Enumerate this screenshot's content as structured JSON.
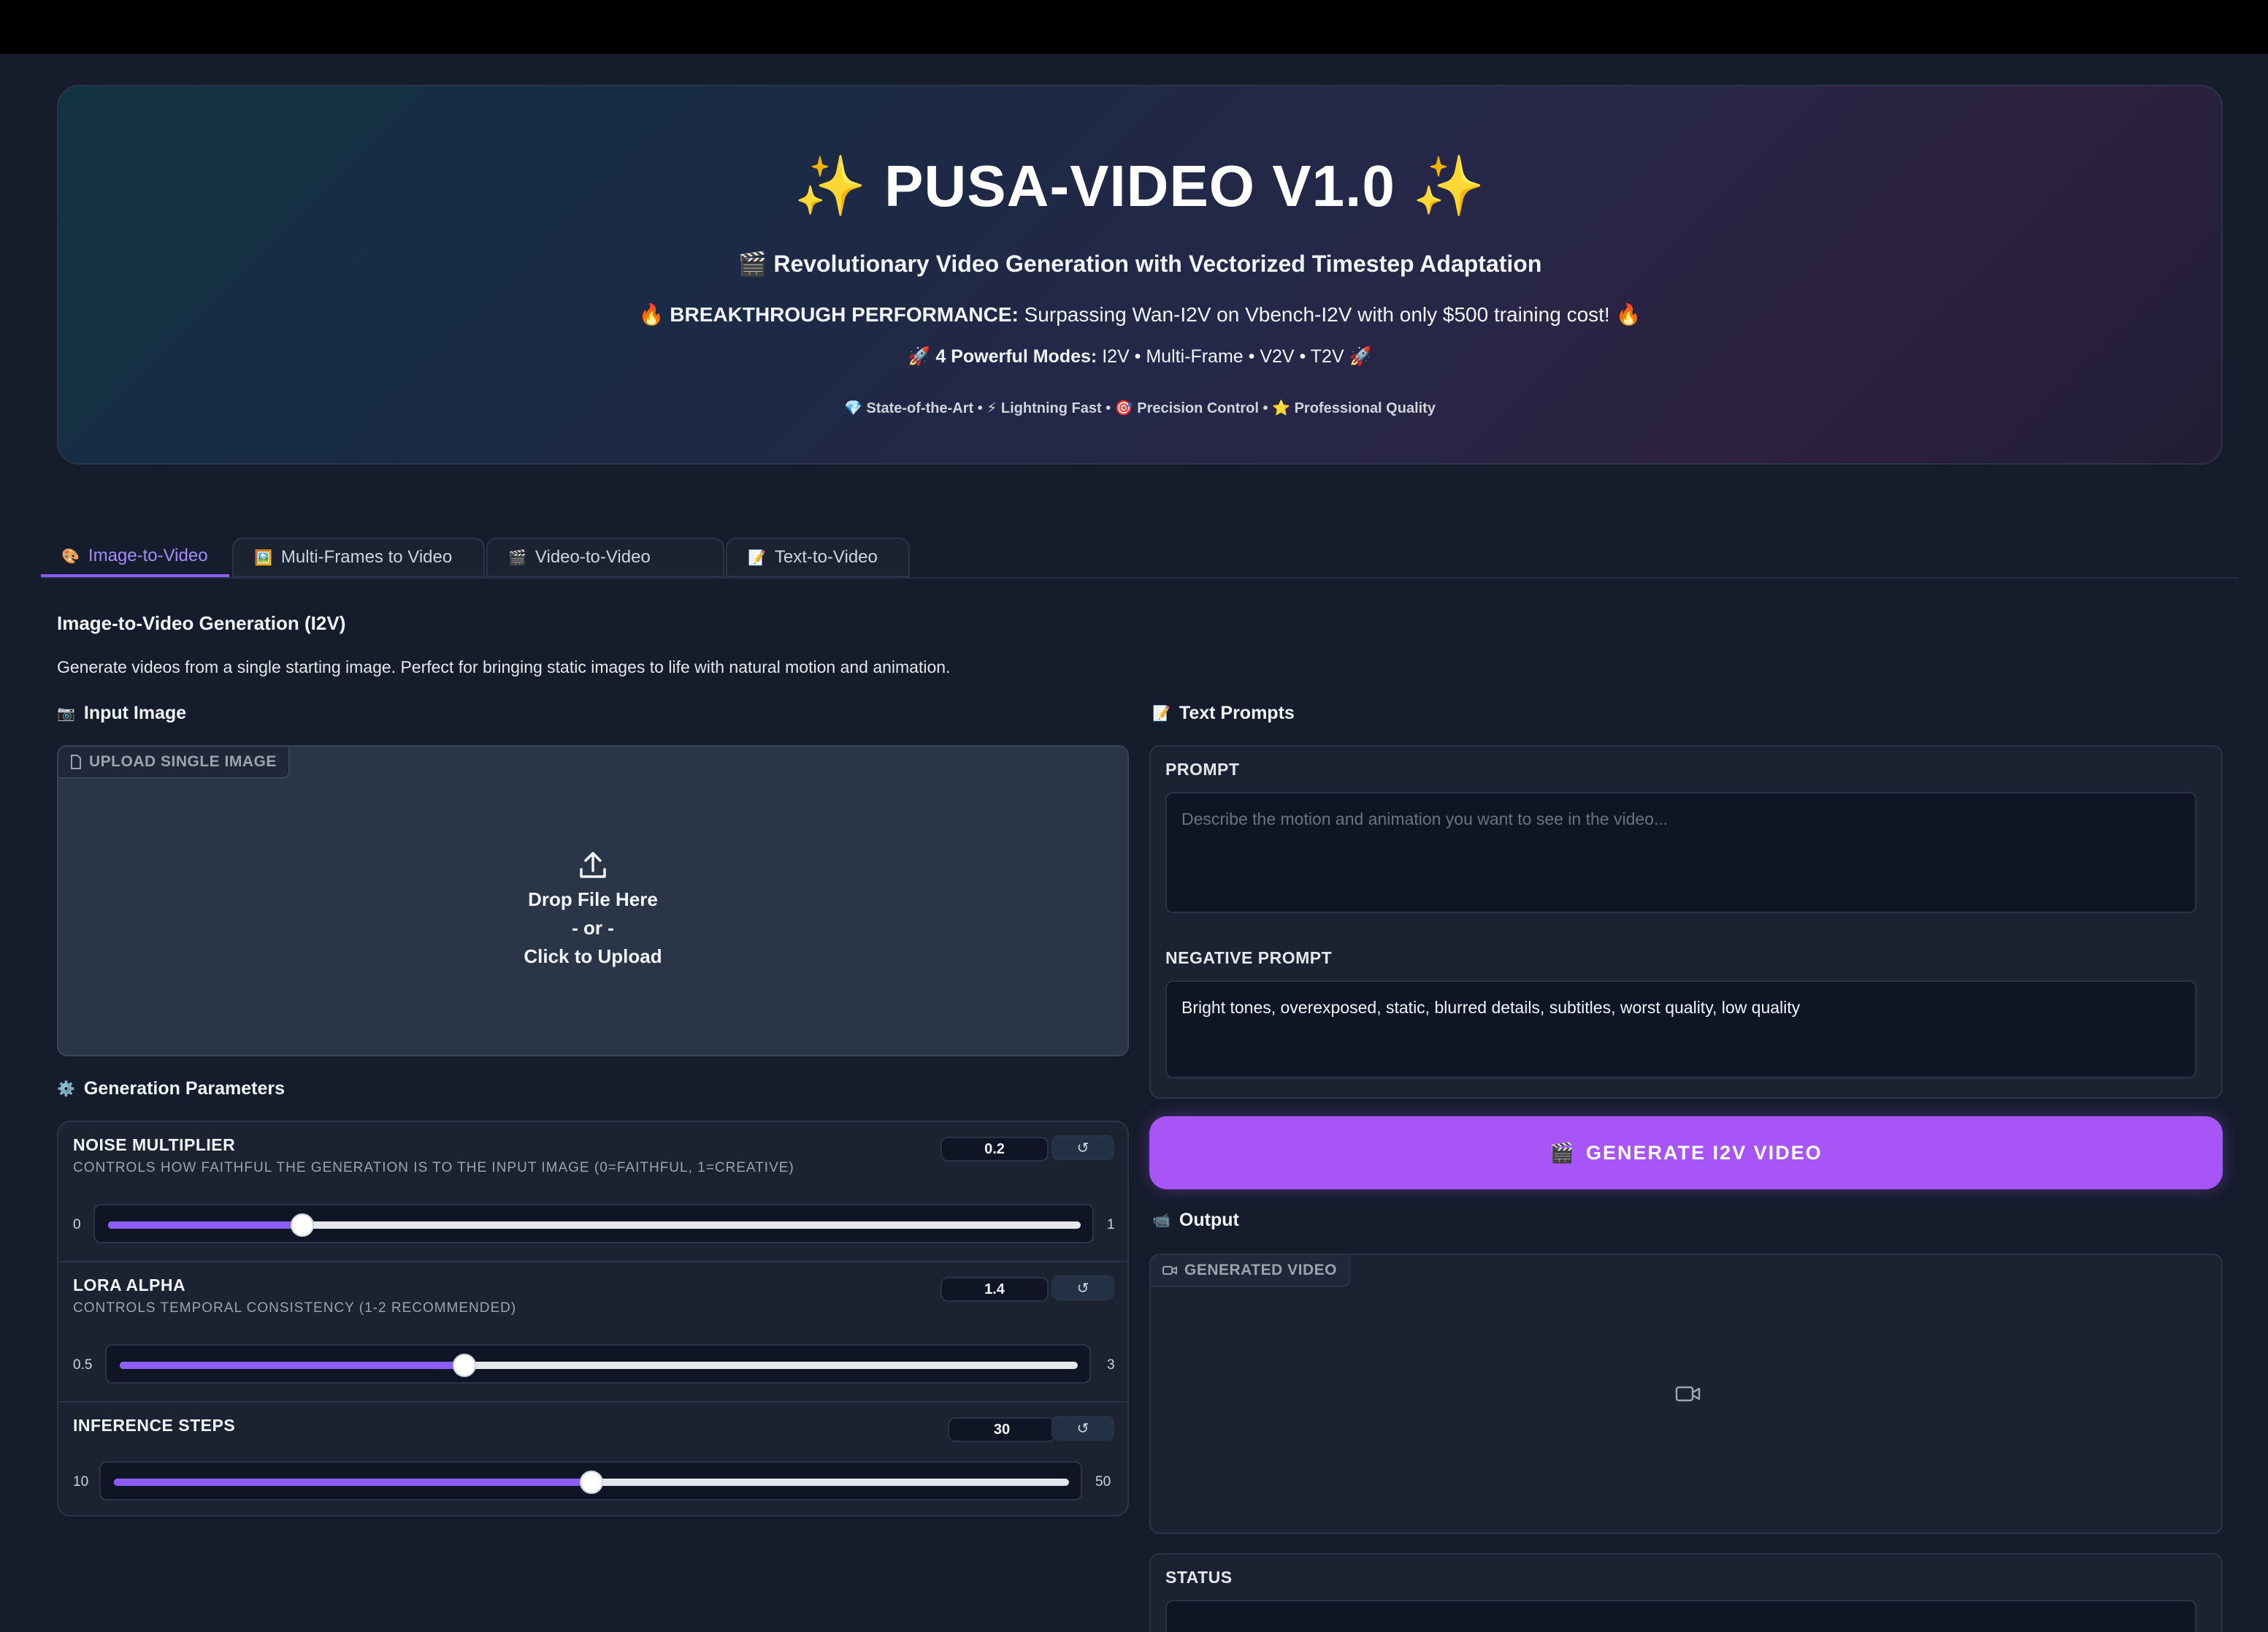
{
  "header": {
    "title": "PUSA-VIDEO V1.0",
    "title_emoji": "✨",
    "subtitle_emoji": "🎬",
    "subtitle": "Revolutionary Video Generation with Vectorized Timestep Adaptation",
    "perf_emoji": "🔥",
    "perf_bold": "BREAKTHROUGH PERFORMANCE:",
    "perf_text": "Surpassing Wan-I2V on Vbench-I2V with only $500 training cost!",
    "modes_emoji": "🚀",
    "modes_bold": "4 Powerful Modes:",
    "modes_text": "I2V • Multi-Frame • V2V • T2V",
    "features": [
      {
        "emoji": "💎",
        "label": "State-of-the-Art"
      },
      {
        "emoji": "⚡",
        "label": "Lightning Fast"
      },
      {
        "emoji": "🎯",
        "label": "Precision Control"
      },
      {
        "emoji": "⭐",
        "label": "Professional Quality"
      }
    ],
    "feature_sep": "•"
  },
  "tabs": [
    {
      "icon": "🎨",
      "label": "Image-to-Video",
      "active": true
    },
    {
      "icon": "🖼️",
      "label": "Multi-Frames to Video"
    },
    {
      "icon": "🎬",
      "label": "Video-to-Video"
    },
    {
      "icon": "📝",
      "label": "Text-to-Video"
    }
  ],
  "section": {
    "title": "Image-to-Video Generation (I2V)",
    "description": "Generate videos from a single starting image. Perfect for bringing static images to life with natural motion and animation."
  },
  "input_image": {
    "group_icon": "📷",
    "group_label": "Input Image",
    "tag": "UPLOAD SINGLE IMAGE",
    "drop_text": "Drop File Here",
    "or_text": "- or -",
    "click_text": "Click to Upload"
  },
  "params": {
    "group_icon": "⚙️",
    "group_label": "Generation Parameters",
    "reset_glyph": "↺",
    "noise": {
      "label": "NOISE MULTIPLIER",
      "info": "CONTROLS HOW FAITHFUL THE GENERATION IS TO THE INPUT IMAGE (0=FAITHFUL, 1=CREATIVE)",
      "value": "0.2",
      "min": "0",
      "max": "1",
      "fraction": 0.2
    },
    "lora": {
      "label": "LORA ALPHA",
      "info": "CONTROLS TEMPORAL CONSISTENCY (1-2 RECOMMENDED)",
      "value": "1.4",
      "min": "0.5",
      "max": "3",
      "fraction": 0.36
    },
    "steps": {
      "label": "INFERENCE STEPS",
      "value": "30",
      "min": "10",
      "max": "50",
      "fraction": 0.5
    }
  },
  "prompts": {
    "group_icon": "📝",
    "group_label": "Text Prompts",
    "prompt_label": "PROMPT",
    "prompt_placeholder": "Describe the motion and animation you want to see in the video...",
    "negative_label": "NEGATIVE PROMPT",
    "negative_value": "Bright tones, overexposed, static, blurred details, subtitles, worst quality, low quality"
  },
  "generate": {
    "icon": "🎬",
    "label": "GENERATE I2V VIDEO"
  },
  "output": {
    "group_icon": "📹",
    "group_label": "Output",
    "tag": "GENERATED VIDEO"
  },
  "status": {
    "label": "STATUS"
  },
  "colors": {
    "accent": "#8b5cf6",
    "button": "#a855f7",
    "background": "#151c2c"
  }
}
